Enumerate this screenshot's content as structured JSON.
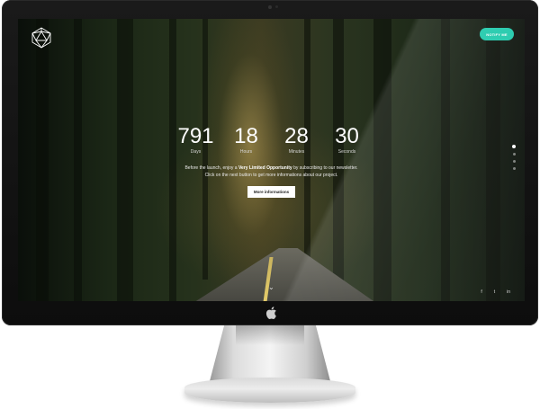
{
  "page": {
    "brand_icon": "geometric-polyhedron-logo-icon"
  },
  "header": {
    "notify_label": "NOTIFY ME"
  },
  "countdown": [
    {
      "value": "791",
      "label": "Days"
    },
    {
      "value": "18",
      "label": "Hours"
    },
    {
      "value": "28",
      "label": "Minutes"
    },
    {
      "value": "30",
      "label": "Seconds"
    }
  ],
  "message": {
    "line1_pre": "Before the launch, enjoy a ",
    "line1_bold": "Very Limited Opportunity",
    "line1_post": " by subscribing to our newsletter.",
    "line2": "Click on the next button to get more informations about our project."
  },
  "cta": {
    "label": "More informations"
  },
  "social": [
    {
      "icon": "facebook-icon",
      "glyph": "f"
    },
    {
      "icon": "twitter-icon",
      "glyph": "t"
    },
    {
      "icon": "linkedin-icon",
      "glyph": "in"
    }
  ],
  "nav_dots": {
    "count": 4,
    "active_index": 0
  },
  "colors": {
    "accent": "#1fc9ab"
  }
}
